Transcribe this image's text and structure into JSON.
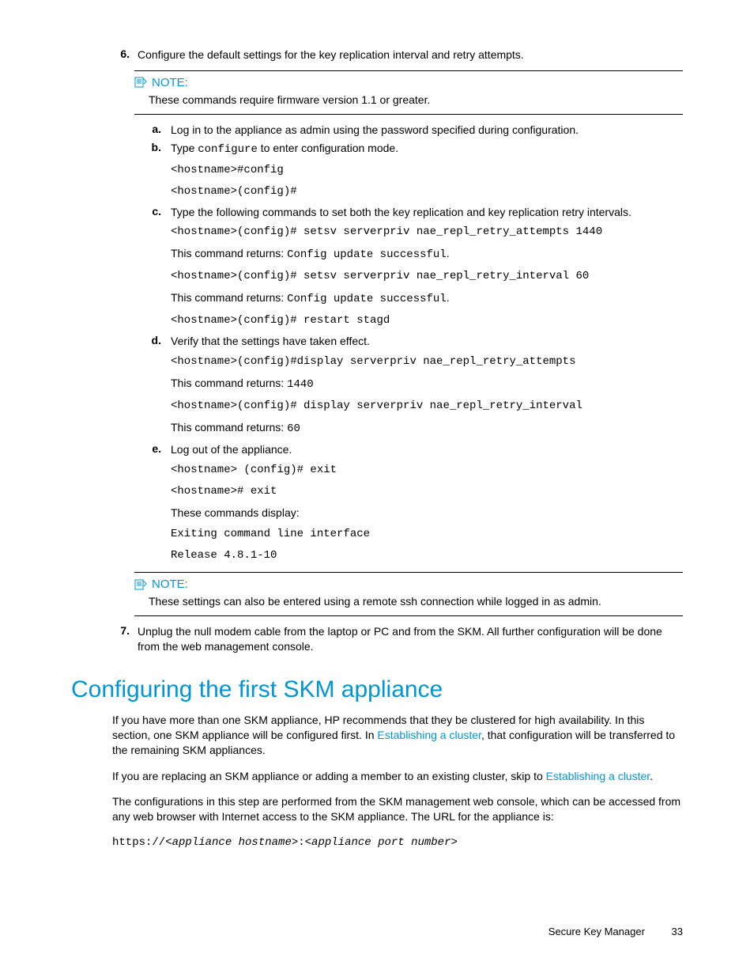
{
  "steps": {
    "s6": {
      "num": "6.",
      "text": "Configure the default settings for the key replication interval and retry attempts."
    },
    "s7": {
      "num": "7.",
      "text": "Unplug the null modem cable from the laptop or PC and from the SKM. All further configuration will be done from the web management console."
    }
  },
  "note1": {
    "label": "NOTE:",
    "text": "These commands require firmware version 1.1 or greater."
  },
  "note2": {
    "label": "NOTE:",
    "text": "These settings can also be entered using a remote ssh connection while logged in as admin."
  },
  "sub": {
    "a": {
      "m": "a.",
      "text": "Log in to the appliance as admin using the password specified during configuration."
    },
    "b": {
      "m": "b.",
      "t1": "Type ",
      "code": "configure",
      "t2": " to enter configuration mode.",
      "l1": "<hostname>#config",
      "l2": "<hostname>(config)#"
    },
    "c": {
      "m": "c.",
      "text": "Type the following commands to set both the key replication and key replication retry intervals.",
      "l1": "<hostname>(config)# setsv serverpriv nae_repl_retry_attempts 1440",
      "r1a": "This command returns: ",
      "r1b": "Config update successful",
      "l2": "<hostname>(config)# setsv serverpriv nae_repl_retry_interval 60",
      "r2a": "This command returns: ",
      "r2b": "Config update successful",
      "l3": "<hostname>(config)# restart stagd"
    },
    "d": {
      "m": "d.",
      "text": "Verify that the settings have taken effect.",
      "l1": "<hostname>(config)#display serverpriv nae_repl_retry_attempts",
      "r1a": "This command returns: ",
      "r1b": "1440",
      "l2": "<hostname>(config)# display serverpriv nae_repl_retry_interval",
      "r2a": "This command returns: ",
      "r2b": "60"
    },
    "e": {
      "m": "e.",
      "text": "Log out of the appliance.",
      "l1": "<hostname> (config)# exit",
      "l2": "<hostname># exit",
      "disp": "These commands display:",
      "l3": "Exiting command line interface",
      "l4": "Release 4.8.1-10"
    }
  },
  "section": {
    "title": "Configuring the first SKM appliance"
  },
  "p1": {
    "a": "If you have more than one SKM appliance, HP recommends that they be clustered for high availability. In this section, one SKM appliance will be configured first. In ",
    "link": "Establishing a cluster",
    "b": ", that configuration will be transferred to the remaining SKM appliances."
  },
  "p2": {
    "a": "If you are replacing an SKM appliance or adding a member to an existing cluster, skip to ",
    "link": "Establishing a cluster",
    "b": "."
  },
  "p3": "The configurations in this step are performed from the SKM management web console, which can be accessed from any web browser with Internet access to the SKM appliance. The URL for the appliance is:",
  "url": {
    "proto": "https://",
    "host": "<appliance hostname>",
    "sep": ":",
    "port": "<appliance port number>"
  },
  "footer": {
    "title": "Secure Key Manager",
    "page": "33"
  }
}
